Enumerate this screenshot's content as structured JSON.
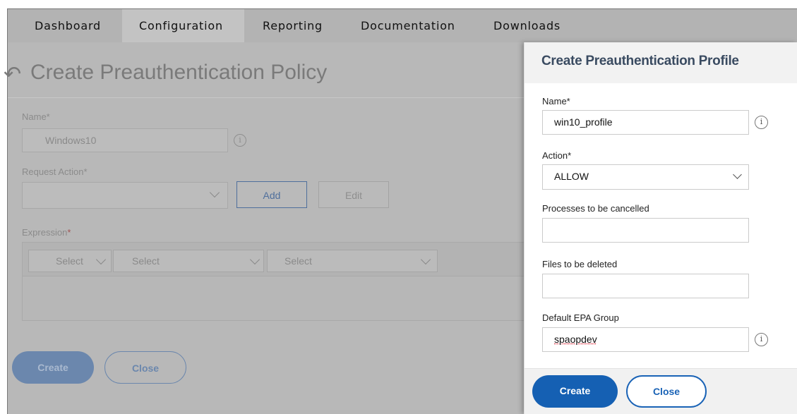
{
  "nav": {
    "tabs": [
      {
        "label": "Dashboard"
      },
      {
        "label": "Configuration",
        "active": true
      },
      {
        "label": "Reporting"
      },
      {
        "label": "Documentation"
      },
      {
        "label": "Downloads"
      }
    ]
  },
  "policy_form": {
    "title": "Create Preauthentication Policy",
    "name_label": "Name*",
    "name_value": "Windows10",
    "request_action_label": "Request Action*",
    "request_action_value": "",
    "add_label": "Add",
    "edit_label": "Edit",
    "expression_label": "Expression",
    "expression_required_mark": "*",
    "expression_selects": [
      "Select",
      "Select",
      "Select"
    ],
    "create_label": "Create",
    "close_label": "Close"
  },
  "profile_panel": {
    "title": "Create Preauthentication Profile",
    "name_label": "Name*",
    "name_value": "win10_profile",
    "action_label": "Action*",
    "action_value": "ALLOW",
    "processes_label": "Processes to be cancelled",
    "processes_value": "",
    "files_label": "Files to be deleted",
    "files_value": "",
    "epa_group_label": "Default EPA Group",
    "epa_group_value": "spaopdev",
    "create_label": "Create",
    "close_label": "Close"
  },
  "colors": {
    "primary": "#1560b3",
    "panel_title": "#3a4b61",
    "overlay": "#b8b8b8"
  }
}
